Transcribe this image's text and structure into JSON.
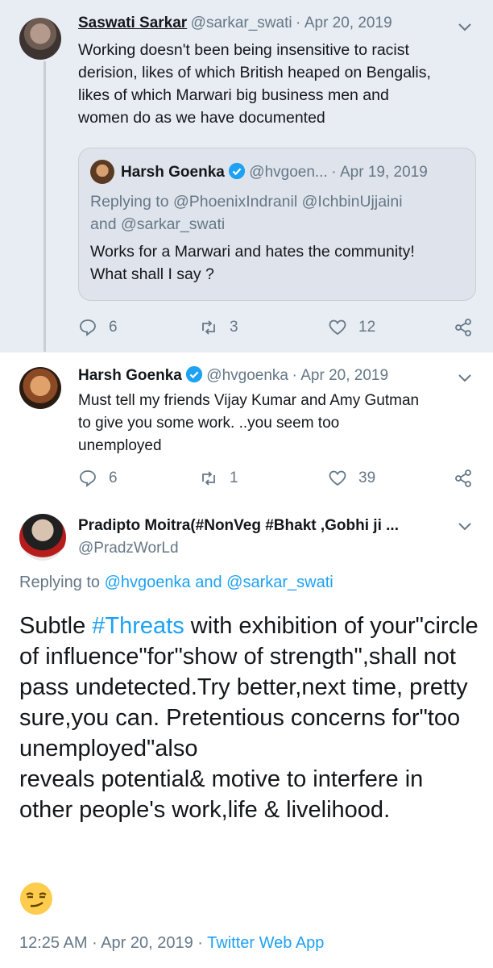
{
  "tweet1": {
    "name": "Saswati Sarkar",
    "handle": "@sarkar_swati",
    "separator": "·",
    "date": "Apr 20, 2019",
    "lines": [
      "Working doesn't been being insensitive to racist",
      "derision, likes of which British heaped on Bengalis,",
      "likes of which Marwari big business men and",
      "women do as we have documented"
    ],
    "quote": {
      "name": "Harsh Goenka",
      "handle": "@hvgoen...",
      "separator": "·",
      "date": "Apr 19, 2019",
      "replying_line1": "Replying to @PhoenixIndranil @IchbinUjjaini",
      "replying_line2": "and @sarkar_swati",
      "text_line1": "Works for a Marwari and hates the community!",
      "text_line2": "What shall I say ?"
    },
    "replies": "6",
    "retweets": "3",
    "likes": "12"
  },
  "tweet2": {
    "name": "Harsh Goenka",
    "handle": "@hvgoenka",
    "separator": "·",
    "date": "Apr 20, 2019",
    "lines": [
      "Must tell my friends Vijay Kumar and Amy Gutman",
      "to give you some work. ..you seem too",
      "unemployed"
    ],
    "replies": "6",
    "retweets": "1",
    "likes": "39"
  },
  "tweet3": {
    "name": "Pradipto Moitra(#NonVeg #Bhakt ,Gobhi ji ...",
    "handle": "@PradzWorLd",
    "replying_prefix": "Replying to",
    "replying_users": "@hvgoenka and @sarkar_swati",
    "text_pre": "Subtle ",
    "hashtag": "#Threats",
    "text_post": " with exhibition of your\"circle of influence\"for\"show of strength\",shall not pass undetected.Try better,next time, pretty sure,you can. Pretentious concerns for\"too unemployed\"also",
    "text_line2": "reveals potential& motive to interfere in other people's work,life & livelihood.",
    "time": "12:25 AM",
    "separator": "·",
    "date": "Apr 20, 2019",
    "separator2": "·",
    "source": "Twitter Web App"
  },
  "colors": {
    "accent": "#1da1f2",
    "muted": "#657786",
    "thread_bg": "#e8ecf3"
  }
}
